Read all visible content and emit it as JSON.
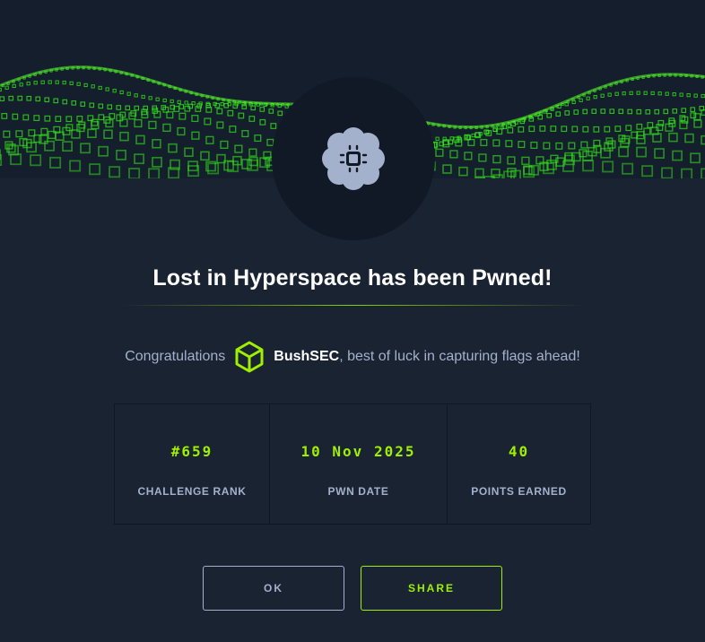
{
  "modal": {
    "title": "Lost in Hyperspace has been Pwned!",
    "badge_icon": "chip-brain-icon",
    "banner_image": "green-hex-wave-banner"
  },
  "congrats": {
    "prefix": "Congratulations",
    "user_icon": "cube-avatar-icon",
    "username": "BushSEC",
    "suffix": ", best of luck in capturing flags ahead!"
  },
  "stats": [
    {
      "value": "#659",
      "label": "CHALLENGE RANK"
    },
    {
      "value": "10 Nov 2025",
      "label": "PWN DATE"
    },
    {
      "value": "40",
      "label": "POINTS EARNED"
    }
  ],
  "buttons": {
    "ok_label": "OK",
    "share_label": "SHARE"
  },
  "colors": {
    "background": "#1a2332",
    "accent_green": "#9fef00",
    "muted_text": "#a4b1cd",
    "badge_bg": "#111927"
  }
}
